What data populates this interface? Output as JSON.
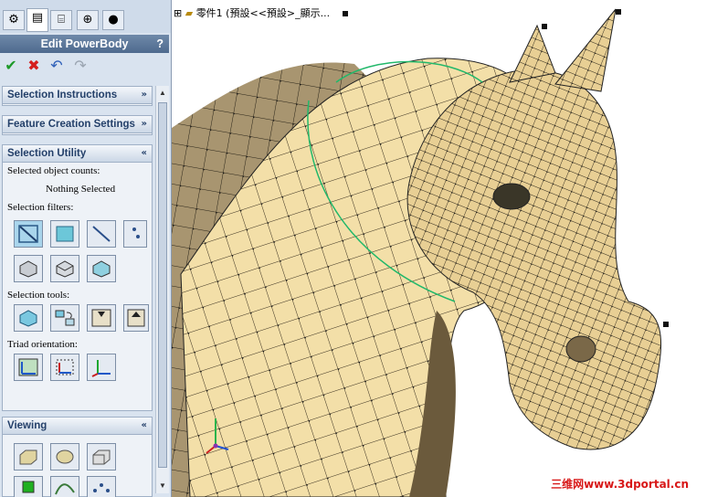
{
  "panel": {
    "title": "Edit PowerBody",
    "help": "?",
    "tabs": [
      "feature-manager-icon",
      "property-manager-icon",
      "configuration-manager-icon",
      "dim-xpert-icon",
      "appearance-icon"
    ],
    "actions": {
      "ok": "✔",
      "cancel": "✖",
      "undo": "↶",
      "redo": "↷"
    },
    "groups": {
      "selection_instructions": {
        "title": "Selection Instructions",
        "chev": "»"
      },
      "feature_creation": {
        "title": "Feature Creation Settings",
        "chev": "»"
      },
      "selection_utility": {
        "title": "Selection Utility",
        "chev": "«",
        "counts_label": "Selected object counts:",
        "counts_value": "Nothing Selected",
        "filters_label": "Selection filters:",
        "tools_label": "Selection tools:",
        "triad_label": "Triad orientation:"
      },
      "viewing": {
        "title": "Viewing",
        "chev": "«"
      }
    }
  },
  "viewport": {
    "tree_label": "零件1 (預設<<預設>_顯示...",
    "tree_expander": "⊞",
    "watermark": "三维网www.3dportal.cn"
  }
}
